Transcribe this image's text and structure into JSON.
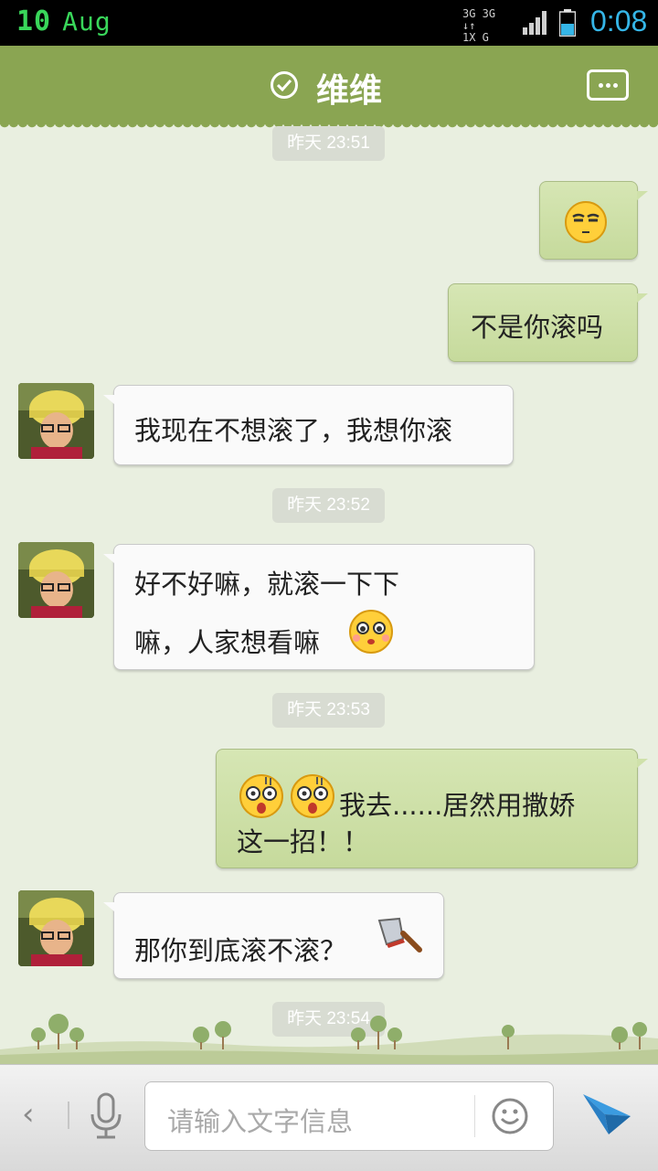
{
  "status_bar": {
    "day": "10",
    "month": "Aug",
    "net_1": "3G 3G",
    "net_2": "↓↑",
    "net_3": "1X G",
    "time": "0:08"
  },
  "header": {
    "title": "维维"
  },
  "timestamps": [
    "昨天 23:51",
    "昨天 23:52",
    "昨天 23:53",
    "昨天 23:54"
  ],
  "messages": [
    {
      "side": "out",
      "text": "",
      "emoji": "smug-face"
    },
    {
      "side": "out",
      "text": "不是你滚吗"
    },
    {
      "side": "in",
      "text": "我现在不想滚了，我想你滚"
    },
    {
      "side": "in",
      "line1": "好不好嘛，就滚一下下",
      "line2": "嘛，人家想看嘛",
      "emoji": "pleading-face"
    },
    {
      "side": "out",
      "line1": "我去......居然用撒娇",
      "line2": "这一招！！",
      "emoji": "shocked-face"
    },
    {
      "side": "in",
      "text": "那你到底滚不滚？",
      "emoji": "cleaver"
    }
  ],
  "input_bar": {
    "placeholder": "请输入文字信息",
    "back_glyph": "‹"
  },
  "colors": {
    "header": "#8aa552",
    "background": "#e9efe0",
    "outgoing_bubble": "#cfe1aa",
    "incoming_bubble": "#fafafa",
    "send": "#2d8fd6"
  }
}
